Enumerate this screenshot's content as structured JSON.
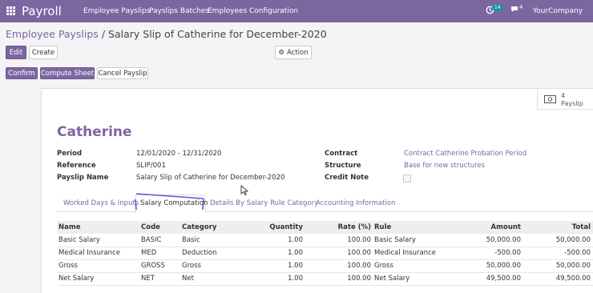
{
  "topbar": {
    "app_name": "Payroll",
    "menu": [
      "Employee Payslips",
      "Payslips Batches",
      "Employees",
      "Configuration"
    ],
    "activity_count": "14",
    "message_count": "4",
    "company": "YourCompany",
    "icons": [
      "apps-grid-icon",
      "activity-clock-icon",
      "chat-icon"
    ]
  },
  "breadcrumb": {
    "parent": "Employee Payslips",
    "separator": "/",
    "current": "Salary Slip of Catherine for December-2020"
  },
  "control": {
    "edit": "Edit",
    "create": "Create",
    "action": "Action"
  },
  "status": {
    "confirm": "Confirm",
    "compute": "Compute Sheet",
    "cancel": "Cancel Payslip"
  },
  "smart_button": {
    "count": "4",
    "label": "Payslip",
    "icon": "money-icon"
  },
  "record": {
    "name": "Catherine",
    "left": [
      {
        "label": "Period",
        "value": "12/01/2020 - 12/31/2020"
      },
      {
        "label": "Reference",
        "value": "SLIP/001"
      },
      {
        "label": "Payslip Name",
        "value": "Salary Slip of Catherine for December-2020"
      }
    ],
    "right": [
      {
        "label": "Contract",
        "value": "Contract Catherine Probation Period"
      },
      {
        "label": "Structure",
        "value": "Base for new structures"
      },
      {
        "label": "Credit Note",
        "value": ""
      }
    ]
  },
  "tabs": [
    "Worked Days & Inputs",
    "Salary Computation",
    "Details By Salary Rule Category",
    "Accounting Information"
  ],
  "table": {
    "headers": [
      "Name",
      "Code",
      "Category",
      "Quantity",
      "Rate (%)",
      "Rule",
      "Amount",
      "Total"
    ],
    "rows": [
      [
        "Basic Salary",
        "BASIC",
        "Basic",
        "1.00",
        "100.00",
        "Basic Salary",
        "50,000.00",
        "50,000.00"
      ],
      [
        "Medical Insurance",
        "MED",
        "Deduction",
        "1.00",
        "100.00",
        "Medical Insurance",
        "-500.00",
        "-500.00"
      ],
      [
        "Gross",
        "GROSS",
        "Gross",
        "1.00",
        "100.00",
        "Gross",
        "50,000.00",
        "50,000.00"
      ],
      [
        "Net Salary",
        "NET",
        "Net",
        "1.00",
        "100.00",
        "Net Salary",
        "49,500.00",
        "49,500.00"
      ]
    ]
  },
  "colors": {
    "brand": "#7c66a0",
    "badge": "#00a09d"
  }
}
